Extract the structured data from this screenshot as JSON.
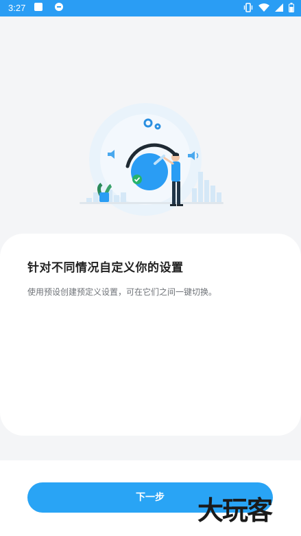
{
  "status_bar": {
    "time": "3:27",
    "left_icons": [
      "notification-a-icon",
      "message-icon"
    ],
    "right_icons": [
      "vibrate-icon",
      "wifi-icon",
      "signal-icon",
      "battery-icon"
    ],
    "color": "#2a9df4"
  },
  "onboarding": {
    "illustration": "volume-knob-person-illustration",
    "title": "针对不同情况自定义你的设置",
    "description": "使用预设创建预定义设置，可在它们之间一键切换。"
  },
  "footer": {
    "next_label": "下一步",
    "button_color": "#29a4f5",
    "watermark": "大玩客"
  }
}
